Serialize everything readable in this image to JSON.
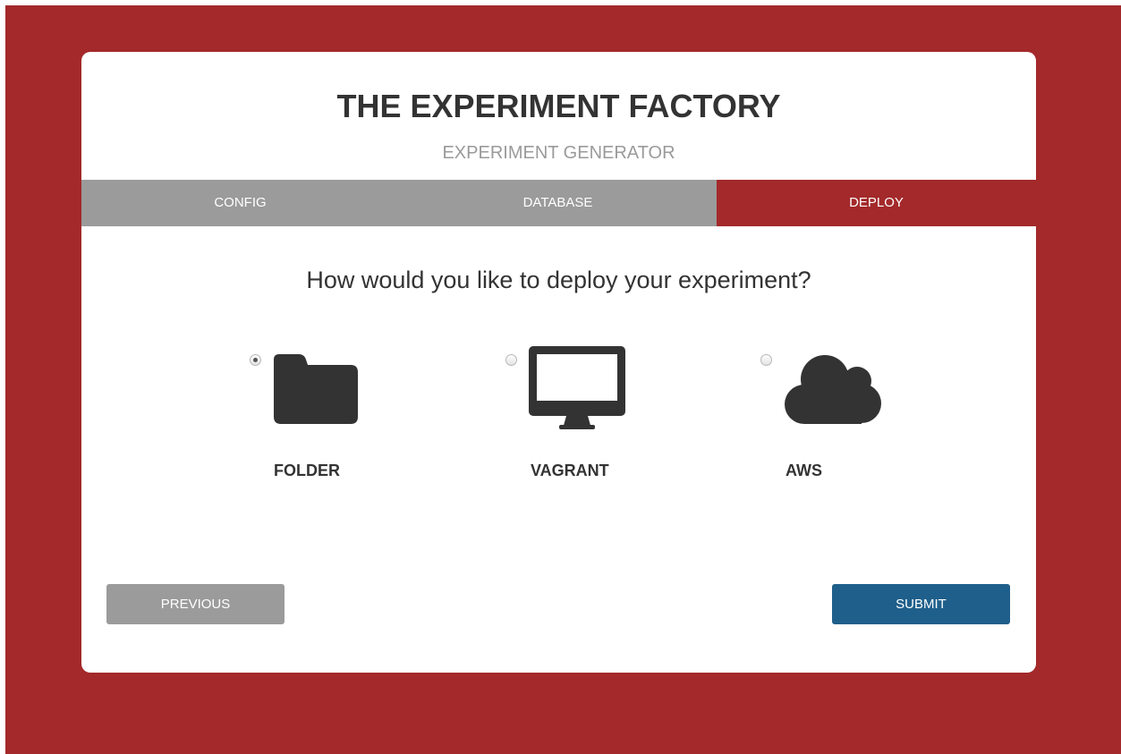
{
  "header": {
    "title": "THE EXPERIMENT FACTORY",
    "subtitle": "EXPERIMENT GENERATOR"
  },
  "tabs": [
    {
      "label": "CONFIG",
      "active": false
    },
    {
      "label": "DATABASE",
      "active": false
    },
    {
      "label": "DEPLOY",
      "active": true
    }
  ],
  "question": "How would you like to deploy your experiment?",
  "options": [
    {
      "label": "FOLDER",
      "icon": "folder-icon",
      "selected": true
    },
    {
      "label": "VAGRANT",
      "icon": "monitor-icon",
      "selected": false
    },
    {
      "label": "AWS",
      "icon": "cloud-icon",
      "selected": false
    }
  ],
  "buttons": {
    "previous": "PREVIOUS",
    "submit": "SUBMIT"
  },
  "colors": {
    "accent": "#a3292a",
    "tab_inactive": "#9b9b9b",
    "submit": "#1f5f8b",
    "icon": "#333333"
  }
}
